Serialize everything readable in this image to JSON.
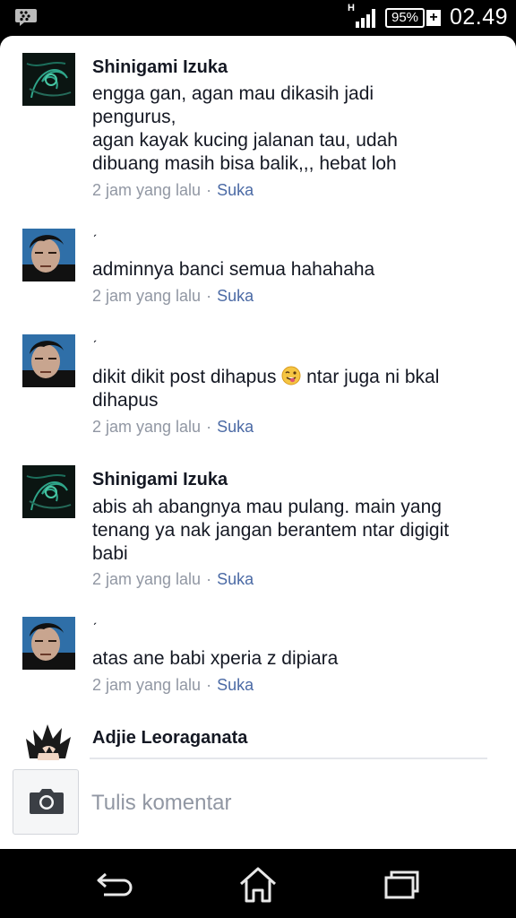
{
  "status_bar": {
    "network_type": "H",
    "battery_percent": "95%",
    "battery_plus": "+",
    "time": "02.49",
    "signal_level": 4
  },
  "comments": [
    {
      "author": "Shinigami Izuka",
      "avatar": "dark-green-art-avatar",
      "lines": [
        "engga gan, agan mau dikasih jadi",
        "pengurus,",
        "agan kayak kucing jalanan tau, udah",
        "dibuang masih bisa balik,,, hebat loh"
      ],
      "time": "2 jam yang lalu",
      "dot": "·",
      "like": "Suka"
    },
    {
      "author": "ˏ",
      "avatar": "man-portrait-avatar",
      "lines": [
        "adminnya banci semua hahahaha"
      ],
      "time": "2 jam yang lalu",
      "dot": "·",
      "like": "Suka"
    },
    {
      "author": "ˏ",
      "avatar": "man-portrait-avatar",
      "lines_before_emoji": "dikit dikit post dihapus ",
      "lines_after_emoji": " ntar juga ni bkal",
      "line2": "dihapus",
      "emoji": "winking-tongue-emoji",
      "time": "2 jam yang lalu",
      "dot": "·",
      "like": "Suka"
    },
    {
      "author": "Shinigami Izuka",
      "avatar": "dark-green-art-avatar",
      "lines": [
        "abis ah abangnya mau pulang. main yang",
        "tenang ya nak jangan berantem ntar digigit",
        "babi"
      ],
      "time": "2 jam yang lalu",
      "dot": "·",
      "like": "Suka"
    },
    {
      "author": "ˏ",
      "avatar": "man-portrait-avatar",
      "lines": [
        "atas ane babi xperia z dipiara"
      ],
      "time": "2 jam yang lalu",
      "dot": "·",
      "like": "Suka"
    },
    {
      "author": "Adjie Leoraganata",
      "avatar": "anime-spiky-hair-avatar"
    }
  ],
  "composer": {
    "placeholder": "Tulis komentar",
    "camera_icon": "camera-icon"
  },
  "nav_bar": {
    "back_icon": "back-icon",
    "home_icon": "home-icon",
    "recents_icon": "recent-apps-icon"
  }
}
